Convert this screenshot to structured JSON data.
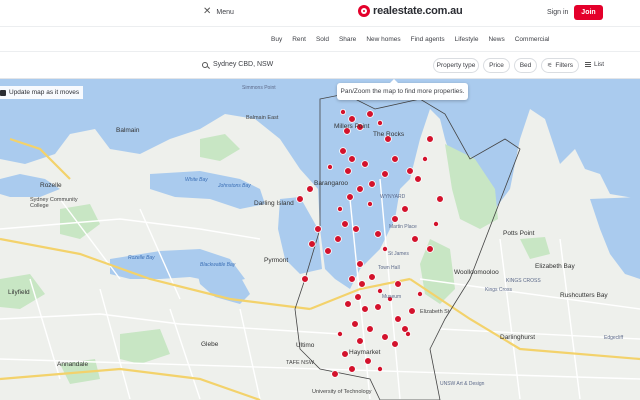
{
  "header": {
    "menu_label": "Menu",
    "logo_text": "realestate.com.au",
    "signin_label": "Sign in",
    "join_label": "Join"
  },
  "nav": {
    "items": [
      "Buy",
      "Rent",
      "Sold",
      "Share",
      "New homes",
      "Find agents",
      "Lifestyle",
      "News",
      "Commercial"
    ]
  },
  "search": {
    "query": "Sydney CBD, NSW",
    "filters": {
      "property_type": "Property type",
      "price": "Price",
      "bed": "Bed",
      "filters": "Filters"
    },
    "list_label": "List"
  },
  "map": {
    "update_label": "Update map as it moves",
    "hint": "Pan/Zoom the map to find more properties.",
    "labels": {
      "simmons_point": "Simmons Point",
      "millers_point": "Millers Point",
      "the_rocks": "The Rocks",
      "balmain": "Balmain",
      "balmain_east": "Balmain East",
      "rozelle": "Rozelle",
      "barangaroo": "Barangaroo",
      "wynyard": "WYNYARD",
      "darling_island": "Darling Island",
      "pyrmont": "Pyrmont",
      "martin_place": "Martin Place",
      "woolloomooloo": "Woolloomooloo",
      "elizabeth_bay": "Elizabeth Bay",
      "potts_point": "Potts Point",
      "kings_cross": "KINGS CROSS",
      "rushcutters_bay": "Rushcutters Bay",
      "darlinghurst": "Darlinghurst",
      "lilyfield": "Lilyfield",
      "glebe": "Glebe",
      "ultimo": "Ultimo",
      "annandale": "Annandale",
      "haymarket": "Haymarket",
      "tafe_nsw": "TAFE NSW",
      "uts": "University of Technology",
      "white_bay": "White Bay",
      "johnstons_bay": "Johnstons Bay",
      "rozelle_bay": "Rozelle Bay",
      "blackwattle_bay": "Blackwattle Bay",
      "sydney_community": "Sydney Community College",
      "unsw": "UNSW Art & Design",
      "kings_cross_st": "Kings Cross",
      "edgecliff": "Edgecliff",
      "st_james": "St James",
      "museum": "Museum",
      "town_hall": "Town Hall",
      "elizabeth_st": "Elizabeth St"
    }
  },
  "colors": {
    "brand": "#e4002b",
    "water": "#aacbee",
    "park": "#c8e6c4",
    "land": "#eef0ec",
    "marker": "#d3122c"
  }
}
